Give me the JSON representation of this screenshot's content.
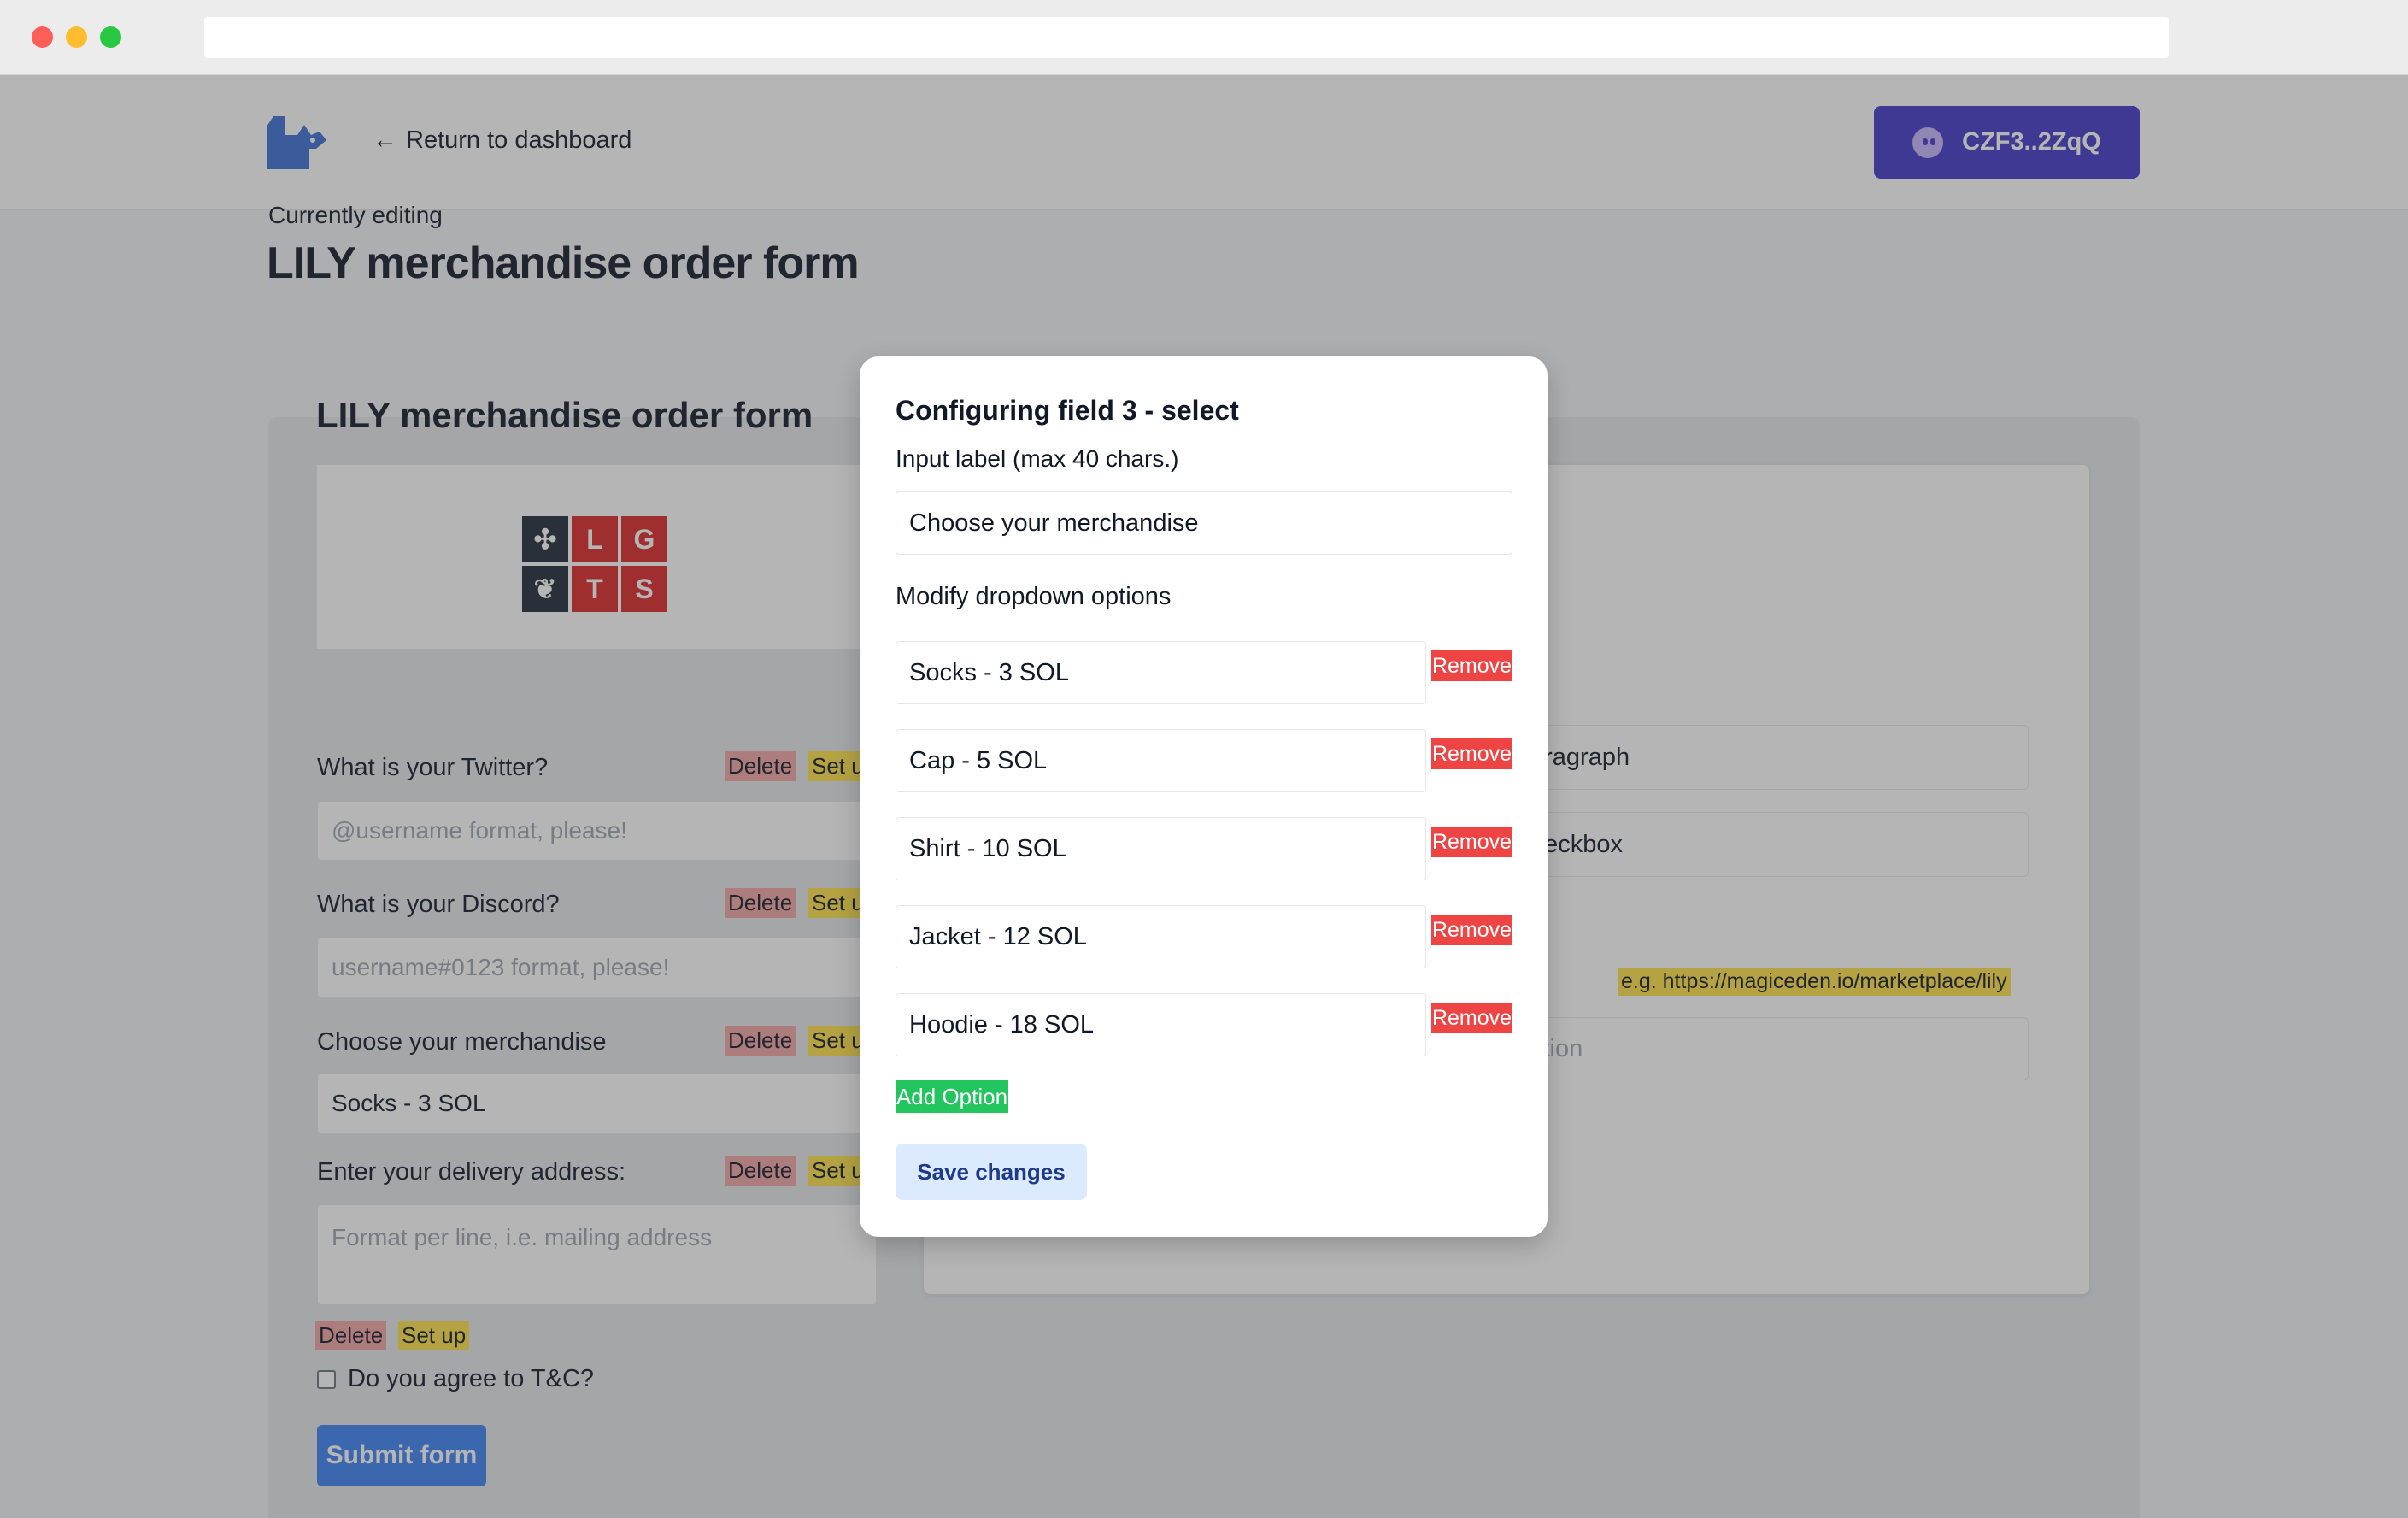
{
  "header": {
    "back_link": "Return to dashboard",
    "wallet": "CZF3..2ZqQ"
  },
  "editor": {
    "currently_editing": "Currently editing",
    "title": "LILY merchandise order form"
  },
  "form": {
    "title": "LILY merchandise order form",
    "banner_letters": [
      "L",
      "G",
      "T",
      "S"
    ],
    "delete_label": "Delete",
    "setup_label": "Set u",
    "setup_label_full": "Set up",
    "questions": [
      {
        "label": "What is your Twitter?",
        "placeholder": "@username format, please!"
      },
      {
        "label": "What is your Discord?",
        "placeholder": "username#0123 format, please!"
      },
      {
        "label": "Choose your merchandise",
        "selected": "Socks - 3 SOL"
      },
      {
        "label": "Enter your delivery address:",
        "placeholder": "Format per line, i.e. mailing address"
      }
    ],
    "agree_label": "Do you agree to T&C?",
    "submit": "Submit form"
  },
  "right_card": {
    "paragraph_fragment": "aragraph",
    "checkbox_fragment": "heckbox",
    "url_hint": "e.g. https://magiceden.io/marketplace/lily",
    "collection_fragment": "ction"
  },
  "modal": {
    "title": "Configuring field 3 - select",
    "input_label": "Input label (max 40 chars.)",
    "input_value": "Choose your merchandise",
    "dropdown_heading": "Modify dropdown options",
    "options": [
      "Socks - 3 SOL",
      "Cap - 5 SOL",
      "Shirt - 10 SOL",
      "Jacket - 12 SOL",
      "Hoodie - 18 SOL"
    ],
    "remove_label": "Remove",
    "add_option": "Add Option",
    "save": "Save changes"
  },
  "colors": {
    "wallet_button": "#4338ca",
    "remove": "#ef4444",
    "add_option": "#22c55e",
    "submit": "#3b82f6"
  }
}
